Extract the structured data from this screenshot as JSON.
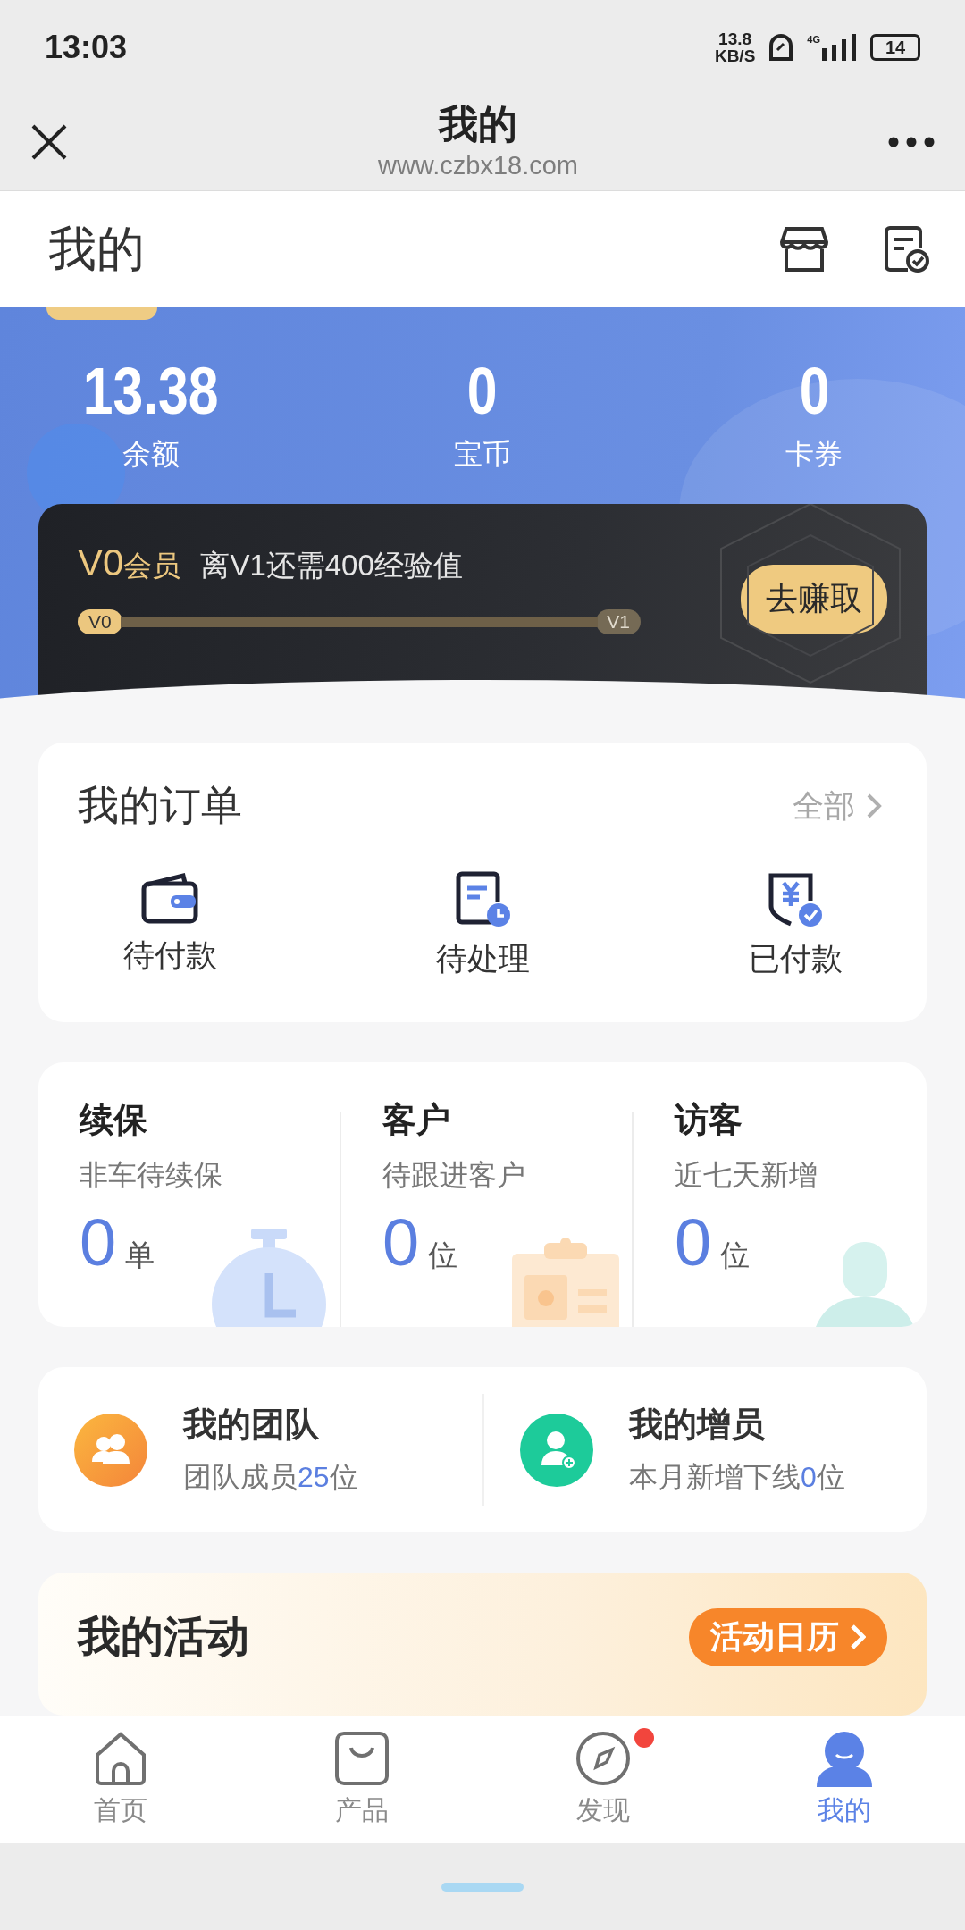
{
  "status_bar": {
    "time": "13:03",
    "speed_value": "13.8",
    "speed_unit": "KB/S",
    "network": "4G",
    "battery": "14"
  },
  "browser_bar": {
    "title": "我的",
    "url": "www.czbx18.com"
  },
  "header": {
    "title": "我的"
  },
  "balances": [
    {
      "value": "13.38",
      "label": "余额"
    },
    {
      "value": "0",
      "label": "宝币"
    },
    {
      "value": "0",
      "label": "卡券"
    }
  ],
  "membership": {
    "level_name": "V0",
    "level_suffix": "会员",
    "hint": "离V1还需400经验值",
    "progress": {
      "start": "V0",
      "end": "V1",
      "level": 0
    },
    "button": "去赚取"
  },
  "orders": {
    "title": "我的订单",
    "more": "全部",
    "items": [
      {
        "kind": "wallet",
        "label": "待付款"
      },
      {
        "kind": "document",
        "label": "待处理"
      },
      {
        "kind": "shield",
        "label": "已付款"
      }
    ]
  },
  "stats": [
    {
      "kind": "stopwatch",
      "title": "续保",
      "subtitle": "非车待续保",
      "value": "0",
      "unit": "单"
    },
    {
      "kind": "clipboard",
      "title": "客户",
      "subtitle": "待跟进客户",
      "value": "0",
      "unit": "位"
    },
    {
      "kind": "person",
      "title": "访客",
      "subtitle": "近七天新增",
      "value": "0",
      "unit": "位"
    }
  ],
  "team": [
    {
      "kind": "group",
      "title": "我的团队",
      "text_before": "团队成员",
      "count": "25",
      "text_after": "位"
    },
    {
      "kind": "add_person",
      "title": "我的增员",
      "text_before": "本月新增下线",
      "count": "0",
      "text_after": "位"
    }
  ],
  "activities": {
    "title": "我的活动",
    "button": "活动日历"
  },
  "nav": [
    {
      "kind": "home",
      "label": "首页",
      "selected": false,
      "badge": false
    },
    {
      "kind": "bag",
      "label": "产品",
      "selected": false,
      "badge": false
    },
    {
      "kind": "compass",
      "label": "发现",
      "selected": false,
      "badge": true
    },
    {
      "kind": "user",
      "label": "我的",
      "selected": true,
      "badge": false
    }
  ]
}
